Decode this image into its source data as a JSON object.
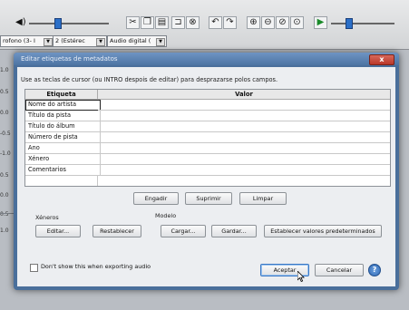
{
  "toolbar": {
    "recording_device": "rofono (3- I",
    "channels": "2 (Estérec",
    "playback_device": "Audio digital ("
  },
  "ruler_labels": [
    "1.0",
    "0.5",
    "0.0",
    "-0.5",
    "-1.0",
    "0.5",
    "0.0",
    "0.5",
    "1.0"
  ],
  "dialog": {
    "title": "Editar etiquetas de metadatos",
    "close_glyph": "x",
    "instruction": "Use as teclas de cursor (ou INTRO despois de editar) para desprazarse polos campos.",
    "grid": {
      "columns": [
        "Etiqueta",
        "Valor"
      ],
      "rows": [
        {
          "tag": "Nome do artista",
          "value": ""
        },
        {
          "tag": "Título da pista",
          "value": ""
        },
        {
          "tag": "Título do álbum",
          "value": ""
        },
        {
          "tag": "Número de pista",
          "value": ""
        },
        {
          "tag": "Ano",
          "value": ""
        },
        {
          "tag": "Xénero",
          "value": ""
        },
        {
          "tag": "Comentarios",
          "value": ""
        }
      ]
    },
    "row_buttons": {
      "add": "Engadir",
      "remove": "Suprimir",
      "clear": "Limpar"
    },
    "genres": {
      "label": "Xéneros",
      "edit": "Editar...",
      "reset": "Restablecer"
    },
    "template": {
      "label": "Modelo",
      "load": "Cargar...",
      "save": "Gardar...",
      "set_default": "Establecer valores predeterminados"
    },
    "dont_show_label": "Don't show this when exporting audio",
    "ok": "Aceptar",
    "cancel": "Cancelar",
    "help_glyph": "?"
  }
}
